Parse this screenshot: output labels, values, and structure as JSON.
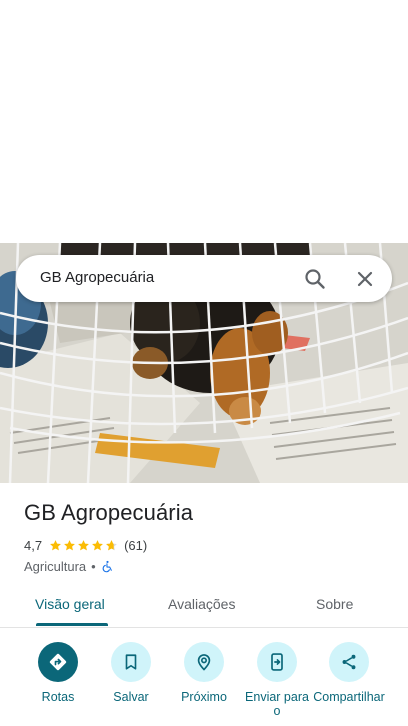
{
  "search": {
    "query": "GB Agropecuária"
  },
  "place": {
    "name": "GB Agropecuária",
    "rating": "4,7",
    "review_count": "(61)",
    "stars": 4.7,
    "category": "Agricultura",
    "separator": "•"
  },
  "tabs": [
    {
      "label": "Visão geral",
      "active": true
    },
    {
      "label": "Avaliações",
      "active": false
    },
    {
      "label": "Sobre",
      "active": false
    }
  ],
  "actions": [
    {
      "label": "Rotas",
      "icon": "directions-icon"
    },
    {
      "label": "Salvar",
      "icon": "bookmark-icon"
    },
    {
      "label": "Próximo",
      "icon": "nearby-icon"
    },
    {
      "label": "Enviar para o",
      "icon": "send-to-phone-icon"
    },
    {
      "label": "Compartilhar",
      "icon": "share-icon"
    }
  ],
  "colors": {
    "accent": "#0b6779",
    "chip": "#d0f4fa",
    "star": "#fbbc04",
    "accessible": "#1a73e8"
  }
}
